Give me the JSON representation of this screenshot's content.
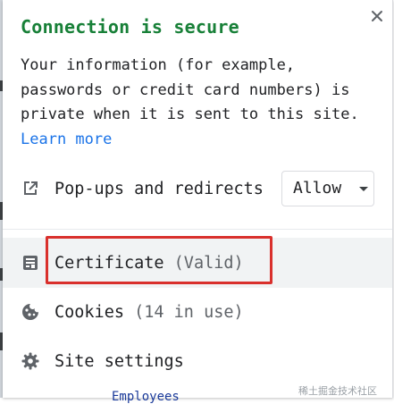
{
  "dialog": {
    "title": "Connection is secure",
    "description": "Your information (for example, passwords or credit card numbers) is private when it is sent to this site.",
    "learn_more": "Learn more",
    "close_icon": "close-icon"
  },
  "popups": {
    "label": "Pop-ups and redirects",
    "icon": "open-in-new-icon",
    "select_value": "Allow"
  },
  "items": {
    "certificate": {
      "label": "Certificate",
      "status": "(Valid)",
      "icon": "certificate-icon"
    },
    "cookies": {
      "label": "Cookies",
      "status": "(14 in use)",
      "icon": "cookie-icon"
    },
    "site_settings": {
      "label": "Site settings",
      "icon": "gear-icon"
    }
  },
  "background": {
    "peek_text": "Employees"
  },
  "watermark": "稀土掘金技术社区",
  "colors": {
    "title_green": "#188038",
    "link_blue": "#1a73e8",
    "highlight_red": "#d9302c",
    "row_hover": "#f1f3f4"
  }
}
